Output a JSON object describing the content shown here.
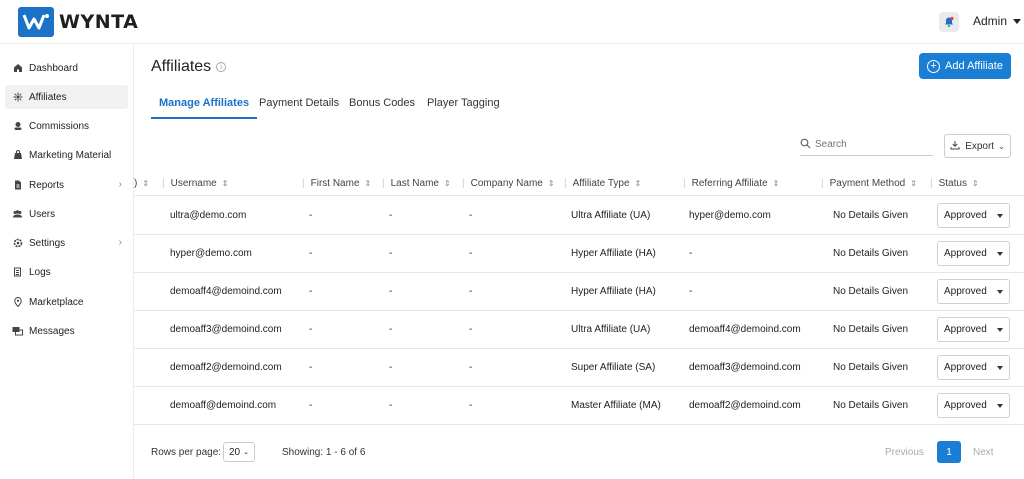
{
  "brand": {
    "name": "WYNTA",
    "accent": "#1a73c8"
  },
  "header": {
    "user": "Admin",
    "notification_icon": "bell-icon"
  },
  "sidebar": {
    "items": [
      {
        "label": "Dashboard",
        "icon": "home-icon"
      },
      {
        "label": "Affiliates",
        "icon": "network-icon",
        "active": true
      },
      {
        "label": "Commissions",
        "icon": "coins-icon"
      },
      {
        "label": "Marketing Material",
        "icon": "bag-icon"
      },
      {
        "label": "Reports",
        "icon": "report-icon",
        "has_submenu": true
      },
      {
        "label": "Users",
        "icon": "users-icon"
      },
      {
        "label": "Settings",
        "icon": "gear-icon",
        "has_submenu": true
      },
      {
        "label": "Logs",
        "icon": "logs-icon"
      },
      {
        "label": "Marketplace",
        "icon": "marketplace-icon"
      },
      {
        "label": "Messages",
        "icon": "messages-icon"
      }
    ]
  },
  "page": {
    "title": "Affiliates",
    "add_button": "Add Affiliate",
    "tabs": [
      {
        "label": "Manage Affiliates",
        "active": true
      },
      {
        "label": "Payment Details"
      },
      {
        "label": "Bonus Codes"
      },
      {
        "label": "Player Tagging"
      }
    ],
    "search_placeholder": "Search",
    "export_label": "Export"
  },
  "table": {
    "columns": [
      "Username",
      "First Name",
      "Last Name",
      "Company Name",
      "Affiliate Type",
      "Referring Affiliate",
      "Payment Method",
      "Status"
    ],
    "rows": [
      {
        "username": "ultra@demo.com",
        "first_name": "-",
        "last_name": "-",
        "company": "-",
        "type": "Ultra Affiliate (UA)",
        "referring": "hyper@demo.com",
        "payment": "No Details Given",
        "status": "Approved"
      },
      {
        "username": "hyper@demo.com",
        "first_name": "-",
        "last_name": "-",
        "company": "-",
        "type": "Hyper Affiliate (HA)",
        "referring": "-",
        "payment": "No Details Given",
        "status": "Approved"
      },
      {
        "username": "demoaff4@demoind.com",
        "first_name": "-",
        "last_name": "-",
        "company": "-",
        "type": "Hyper Affiliate (HA)",
        "referring": "-",
        "payment": "No Details Given",
        "status": "Approved"
      },
      {
        "username": "demoaff3@demoind.com",
        "first_name": "-",
        "last_name": "-",
        "company": "-",
        "type": "Ultra Affiliate (UA)",
        "referring": "demoaff4@demoind.com",
        "payment": "No Details Given",
        "status": "Approved"
      },
      {
        "username": "demoaff2@demoind.com",
        "first_name": "-",
        "last_name": "-",
        "company": "-",
        "type": "Super Affiliate (SA)",
        "referring": "demoaff3@demoind.com",
        "payment": "No Details Given",
        "status": "Approved"
      },
      {
        "username": "demoaff@demoind.com",
        "first_name": "-",
        "last_name": "-",
        "company": "-",
        "type": "Master Affiliate (MA)",
        "referring": "demoaff2@demoind.com",
        "payment": "No Details Given",
        "status": "Approved"
      }
    ]
  },
  "pagination": {
    "rows_per_page_label": "Rows per page:",
    "rows_per_page": "20",
    "showing": "Showing: 1 - 6 of 6",
    "previous": "Previous",
    "current_page": "1",
    "next": "Next"
  }
}
